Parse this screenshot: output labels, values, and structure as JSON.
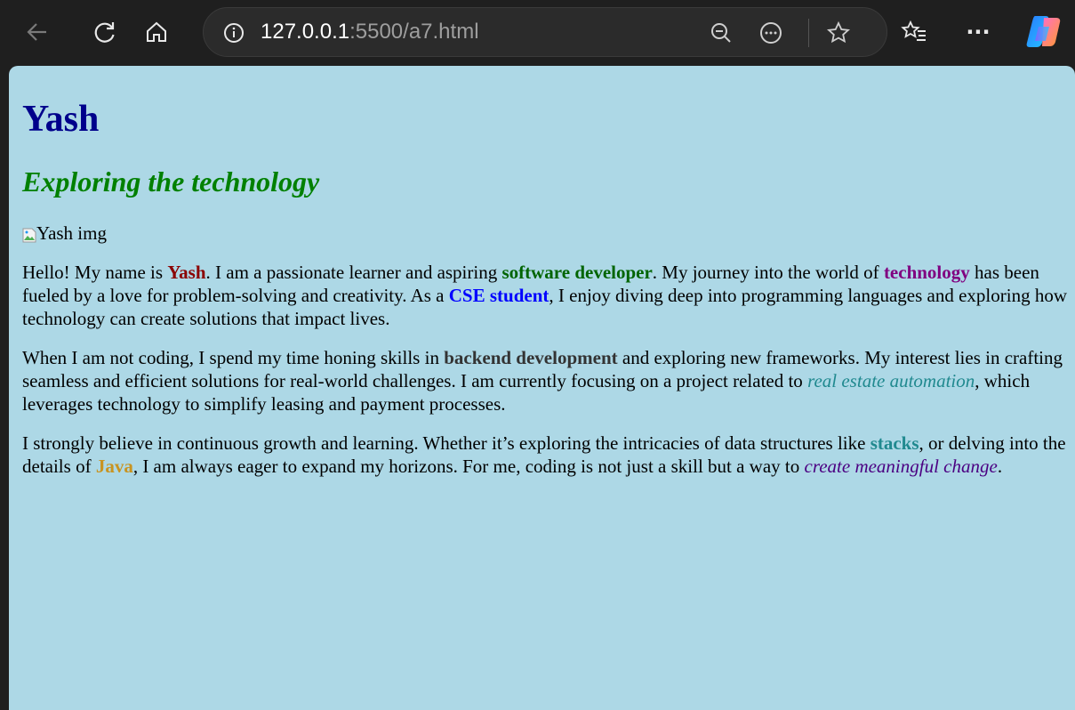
{
  "browser": {
    "url_host": "127.0.0.1",
    "url_rest": ":5500/a7.html",
    "icons": [
      "back-icon",
      "refresh-icon",
      "home-icon",
      "info-icon",
      "zoom-out-icon",
      "more-page-icon",
      "favorite-icon",
      "favorites-list-icon",
      "menu-icon",
      "copilot-icon"
    ],
    "menu_glyph": "···"
  },
  "page": {
    "heading": "Yash",
    "subheading": "Exploring the technology",
    "image_alt": "Yash img",
    "p1": {
      "t1": "Hello! My name is ",
      "name": "Yash",
      "t2": ". I am a passionate learner and aspiring ",
      "role": "software developer",
      "t3": ". My journey into the world of ",
      "tech": "technology",
      "t4": " has been fueled by a love for problem-solving and creativity. As a ",
      "cse": "CSE student",
      "t5": ", I enjoy diving deep into programming languages and exploring how technology can create solutions that impact lives."
    },
    "p2": {
      "t1": "When I am not coding, I spend my time honing skills in ",
      "backend": "backend development",
      "t2": " and exploring new frameworks. My interest lies in crafting seamless and efficient solutions for real-world challenges. I am currently focusing on a project related to ",
      "project": "real estate automation",
      "t3": ", which leverages technology to simplify leasing and payment processes."
    },
    "p3": {
      "t1": "I strongly believe in continuous growth and learning. Whether it’s exploring the intricacies of data structures like ",
      "stacks": "stacks",
      "t2": ", or delving into the details of ",
      "java": "Java",
      "t3": ", I am always eager to expand my horizons. For me, coding is not just a skill but a way to ",
      "change": "create meaningful change",
      "t4": "."
    }
  },
  "colors": {
    "page_bg": "#add8e6",
    "heading": "#00008b",
    "subheading": "#008000"
  }
}
